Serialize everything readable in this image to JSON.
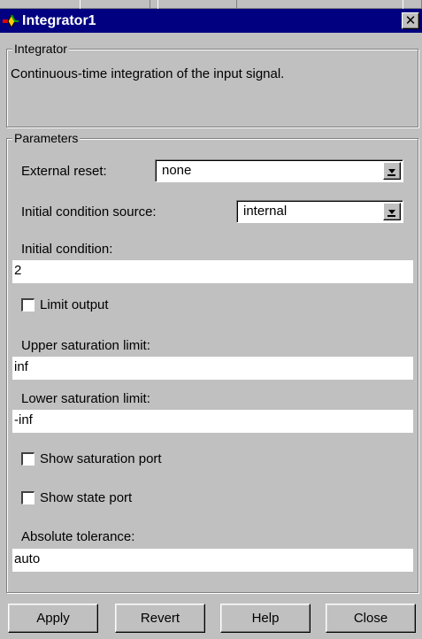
{
  "window": {
    "title": "Integrator1",
    "icon": "simulink-icon",
    "close_glyph": "✕"
  },
  "description_group": {
    "title": "Integrator",
    "text": "Continuous-time integration of the input signal."
  },
  "parameters_group": {
    "title": "Parameters",
    "external_reset": {
      "label": "External reset:",
      "value": "none"
    },
    "initial_condition_source": {
      "label": "Initial condition source:",
      "value": "internal"
    },
    "initial_condition": {
      "label": "Initial condition:",
      "value": "2"
    },
    "limit_output": {
      "label": "Limit output",
      "checked": false
    },
    "upper_saturation_limit": {
      "label": "Upper saturation limit:",
      "value": "inf"
    },
    "lower_saturation_limit": {
      "label": "Lower saturation limit:",
      "value": "-inf"
    },
    "show_saturation_port": {
      "label": "Show saturation port",
      "checked": false
    },
    "show_state_port": {
      "label": "Show state port",
      "checked": false
    },
    "absolute_tolerance": {
      "label": "Absolute tolerance:",
      "value": "auto"
    }
  },
  "buttons": {
    "apply": "Apply",
    "revert": "Revert",
    "help": "Help",
    "close": "Close"
  }
}
